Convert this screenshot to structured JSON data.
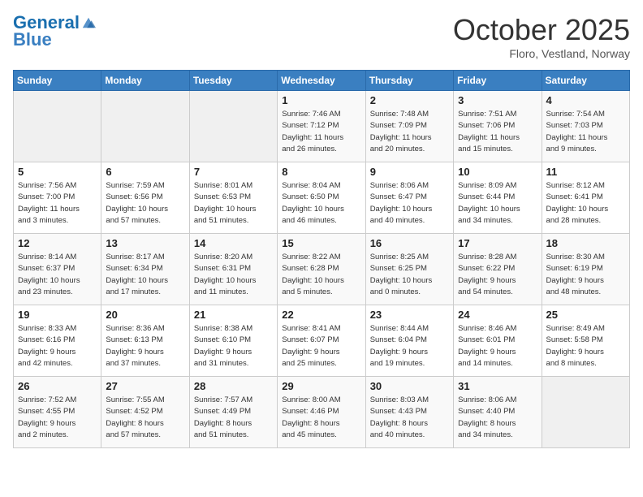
{
  "header": {
    "logo_line1": "General",
    "logo_line2": "Blue",
    "month": "October 2025",
    "location": "Floro, Vestland, Norway"
  },
  "weekdays": [
    "Sunday",
    "Monday",
    "Tuesday",
    "Wednesday",
    "Thursday",
    "Friday",
    "Saturday"
  ],
  "weeks": [
    [
      {
        "day": "",
        "info": ""
      },
      {
        "day": "",
        "info": ""
      },
      {
        "day": "",
        "info": ""
      },
      {
        "day": "1",
        "info": "Sunrise: 7:46 AM\nSunset: 7:12 PM\nDaylight: 11 hours\nand 26 minutes."
      },
      {
        "day": "2",
        "info": "Sunrise: 7:48 AM\nSunset: 7:09 PM\nDaylight: 11 hours\nand 20 minutes."
      },
      {
        "day": "3",
        "info": "Sunrise: 7:51 AM\nSunset: 7:06 PM\nDaylight: 11 hours\nand 15 minutes."
      },
      {
        "day": "4",
        "info": "Sunrise: 7:54 AM\nSunset: 7:03 PM\nDaylight: 11 hours\nand 9 minutes."
      }
    ],
    [
      {
        "day": "5",
        "info": "Sunrise: 7:56 AM\nSunset: 7:00 PM\nDaylight: 11 hours\nand 3 minutes."
      },
      {
        "day": "6",
        "info": "Sunrise: 7:59 AM\nSunset: 6:56 PM\nDaylight: 10 hours\nand 57 minutes."
      },
      {
        "day": "7",
        "info": "Sunrise: 8:01 AM\nSunset: 6:53 PM\nDaylight: 10 hours\nand 51 minutes."
      },
      {
        "day": "8",
        "info": "Sunrise: 8:04 AM\nSunset: 6:50 PM\nDaylight: 10 hours\nand 46 minutes."
      },
      {
        "day": "9",
        "info": "Sunrise: 8:06 AM\nSunset: 6:47 PM\nDaylight: 10 hours\nand 40 minutes."
      },
      {
        "day": "10",
        "info": "Sunrise: 8:09 AM\nSunset: 6:44 PM\nDaylight: 10 hours\nand 34 minutes."
      },
      {
        "day": "11",
        "info": "Sunrise: 8:12 AM\nSunset: 6:41 PM\nDaylight: 10 hours\nand 28 minutes."
      }
    ],
    [
      {
        "day": "12",
        "info": "Sunrise: 8:14 AM\nSunset: 6:37 PM\nDaylight: 10 hours\nand 23 minutes."
      },
      {
        "day": "13",
        "info": "Sunrise: 8:17 AM\nSunset: 6:34 PM\nDaylight: 10 hours\nand 17 minutes."
      },
      {
        "day": "14",
        "info": "Sunrise: 8:20 AM\nSunset: 6:31 PM\nDaylight: 10 hours\nand 11 minutes."
      },
      {
        "day": "15",
        "info": "Sunrise: 8:22 AM\nSunset: 6:28 PM\nDaylight: 10 hours\nand 5 minutes."
      },
      {
        "day": "16",
        "info": "Sunrise: 8:25 AM\nSunset: 6:25 PM\nDaylight: 10 hours\nand 0 minutes."
      },
      {
        "day": "17",
        "info": "Sunrise: 8:28 AM\nSunset: 6:22 PM\nDaylight: 9 hours\nand 54 minutes."
      },
      {
        "day": "18",
        "info": "Sunrise: 8:30 AM\nSunset: 6:19 PM\nDaylight: 9 hours\nand 48 minutes."
      }
    ],
    [
      {
        "day": "19",
        "info": "Sunrise: 8:33 AM\nSunset: 6:16 PM\nDaylight: 9 hours\nand 42 minutes."
      },
      {
        "day": "20",
        "info": "Sunrise: 8:36 AM\nSunset: 6:13 PM\nDaylight: 9 hours\nand 37 minutes."
      },
      {
        "day": "21",
        "info": "Sunrise: 8:38 AM\nSunset: 6:10 PM\nDaylight: 9 hours\nand 31 minutes."
      },
      {
        "day": "22",
        "info": "Sunrise: 8:41 AM\nSunset: 6:07 PM\nDaylight: 9 hours\nand 25 minutes."
      },
      {
        "day": "23",
        "info": "Sunrise: 8:44 AM\nSunset: 6:04 PM\nDaylight: 9 hours\nand 19 minutes."
      },
      {
        "day": "24",
        "info": "Sunrise: 8:46 AM\nSunset: 6:01 PM\nDaylight: 9 hours\nand 14 minutes."
      },
      {
        "day": "25",
        "info": "Sunrise: 8:49 AM\nSunset: 5:58 PM\nDaylight: 9 hours\nand 8 minutes."
      }
    ],
    [
      {
        "day": "26",
        "info": "Sunrise: 7:52 AM\nSunset: 4:55 PM\nDaylight: 9 hours\nand 2 minutes."
      },
      {
        "day": "27",
        "info": "Sunrise: 7:55 AM\nSunset: 4:52 PM\nDaylight: 8 hours\nand 57 minutes."
      },
      {
        "day": "28",
        "info": "Sunrise: 7:57 AM\nSunset: 4:49 PM\nDaylight: 8 hours\nand 51 minutes."
      },
      {
        "day": "29",
        "info": "Sunrise: 8:00 AM\nSunset: 4:46 PM\nDaylight: 8 hours\nand 45 minutes."
      },
      {
        "day": "30",
        "info": "Sunrise: 8:03 AM\nSunset: 4:43 PM\nDaylight: 8 hours\nand 40 minutes."
      },
      {
        "day": "31",
        "info": "Sunrise: 8:06 AM\nSunset: 4:40 PM\nDaylight: 8 hours\nand 34 minutes."
      },
      {
        "day": "",
        "info": ""
      }
    ]
  ]
}
